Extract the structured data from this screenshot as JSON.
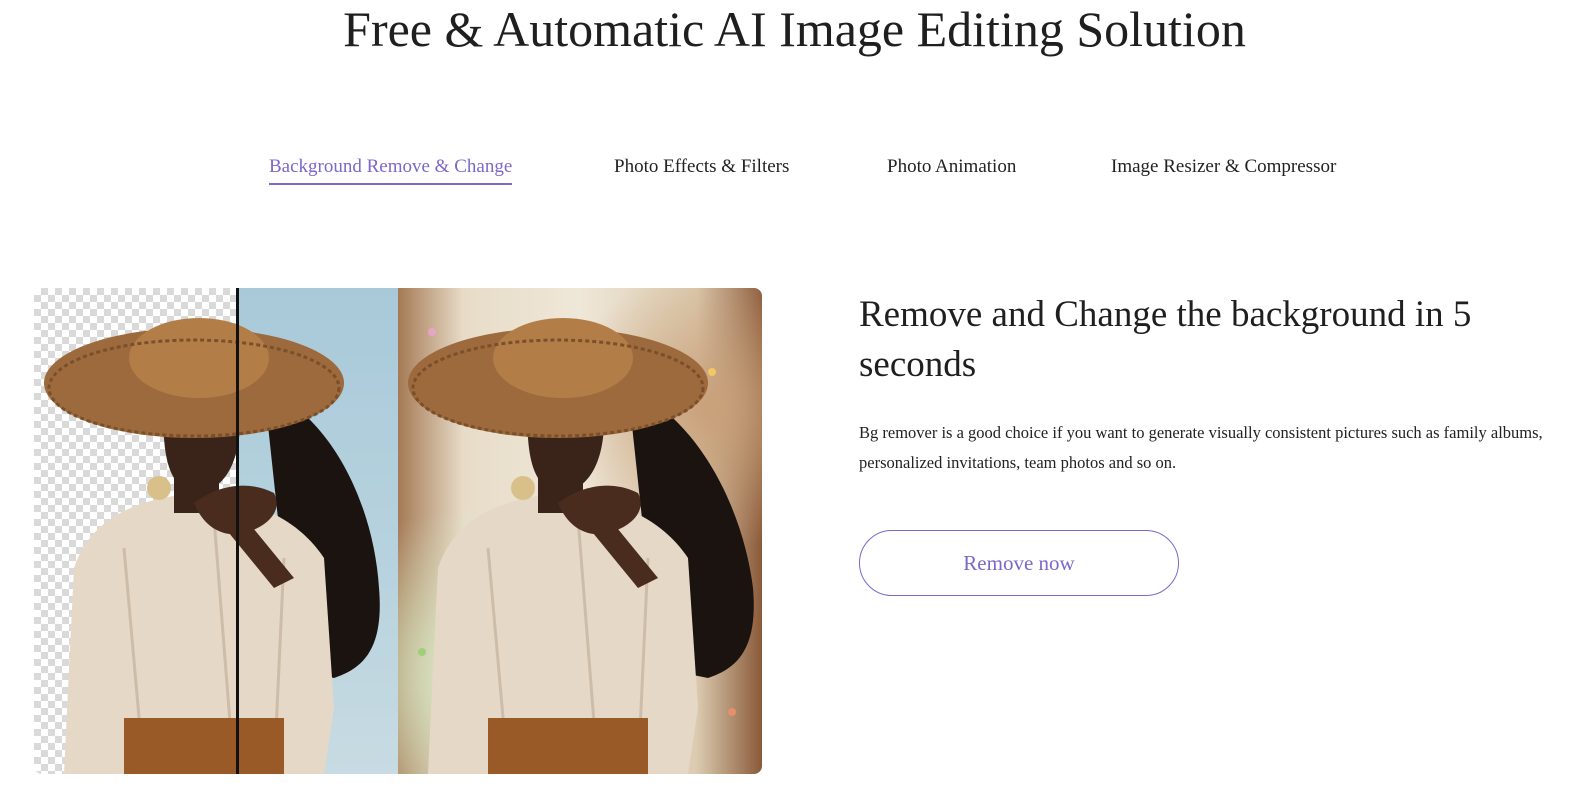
{
  "page": {
    "title": "Free & Automatic AI Image Editing Solution"
  },
  "tabs": [
    {
      "label": "Background Remove & Change",
      "active": true
    },
    {
      "label": "Photo Effects & Filters",
      "active": false
    },
    {
      "label": "Photo Animation",
      "active": false
    },
    {
      "label": "Image Resizer & Compressor",
      "active": false
    }
  ],
  "feature": {
    "heading": "Remove and Change the background in 5 seconds",
    "description": "Bg remover is a good choice if you want to generate visually consistent pictures such as family albums, personalized invitations, team photos and so on.",
    "cta_label": "Remove now"
  },
  "colors": {
    "accent": "#7b68c8",
    "text": "#222222",
    "background": "#ffffff"
  }
}
